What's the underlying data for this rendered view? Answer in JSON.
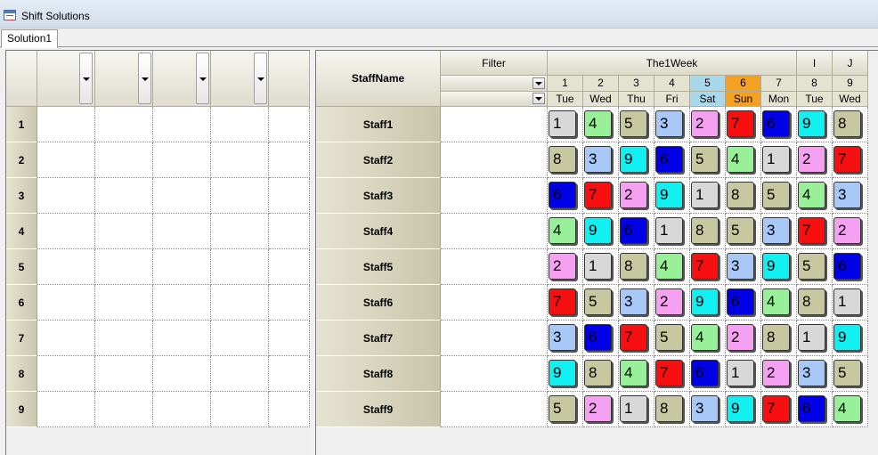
{
  "window": {
    "title": "Shift Solutions"
  },
  "tabs": [
    {
      "label": "Solution1"
    }
  ],
  "left_grid": {
    "row_numbers": [
      "1",
      "2",
      "3",
      "4",
      "5",
      "6",
      "7",
      "8",
      "9"
    ]
  },
  "right_grid": {
    "staff_header": "StaffName",
    "filter_header": "Filter",
    "week_header": "The1Week",
    "extra_headers": [
      "I",
      "J"
    ],
    "day_numbers": [
      "1",
      "2",
      "3",
      "4",
      "5",
      "6",
      "7",
      "8",
      "9"
    ],
    "day_names": [
      "Tue",
      "Wed",
      "Thu",
      "Fri",
      "Sat",
      "Sun",
      "Mon",
      "Tue",
      "Wed"
    ],
    "day_colors": [
      "#e4e2d0",
      "#e4e2d0",
      "#e4e2d0",
      "#e4e2d0",
      "#a8d8ec",
      "#f5a020",
      "#e4e2d0",
      "#e4e2d0",
      "#e4e2d0"
    ],
    "staff": [
      {
        "name": "Staff1",
        "shifts": [
          "1",
          "4",
          "5",
          "3",
          "2",
          "7",
          "6",
          "9",
          "8"
        ]
      },
      {
        "name": "Staff2",
        "shifts": [
          "8",
          "3",
          "9",
          "6",
          "5",
          "4",
          "1",
          "2",
          "7"
        ]
      },
      {
        "name": "Staff3",
        "shifts": [
          "6",
          "7",
          "2",
          "9",
          "1",
          "8",
          "5",
          "4",
          "3"
        ]
      },
      {
        "name": "Staff4",
        "shifts": [
          "4",
          "9",
          "6",
          "1",
          "8",
          "5",
          "3",
          "7",
          "2"
        ]
      },
      {
        "name": "Staff5",
        "shifts": [
          "2",
          "1",
          "8",
          "4",
          "7",
          "3",
          "9",
          "5",
          "6"
        ]
      },
      {
        "name": "Staff6",
        "shifts": [
          "7",
          "5",
          "3",
          "2",
          "9",
          "6",
          "4",
          "8",
          "1"
        ]
      },
      {
        "name": "Staff7",
        "shifts": [
          "3",
          "6",
          "7",
          "5",
          "4",
          "2",
          "8",
          "1",
          "9"
        ]
      },
      {
        "name": "Staff8",
        "shifts": [
          "9",
          "8",
          "4",
          "7",
          "6",
          "1",
          "2",
          "3",
          "5"
        ]
      },
      {
        "name": "Staff9",
        "shifts": [
          "5",
          "2",
          "1",
          "8",
          "3",
          "9",
          "7",
          "6",
          "4"
        ]
      }
    ]
  },
  "shift_colors": {
    "1": "#d8d8d8",
    "2": "#f5a0f0",
    "3": "#a8c8f8",
    "4": "#98f098",
    "5": "#c8c8a0",
    "6": "#0000e8",
    "7": "#f81010",
    "8": "#c8c8a0",
    "9": "#10f0f0"
  }
}
